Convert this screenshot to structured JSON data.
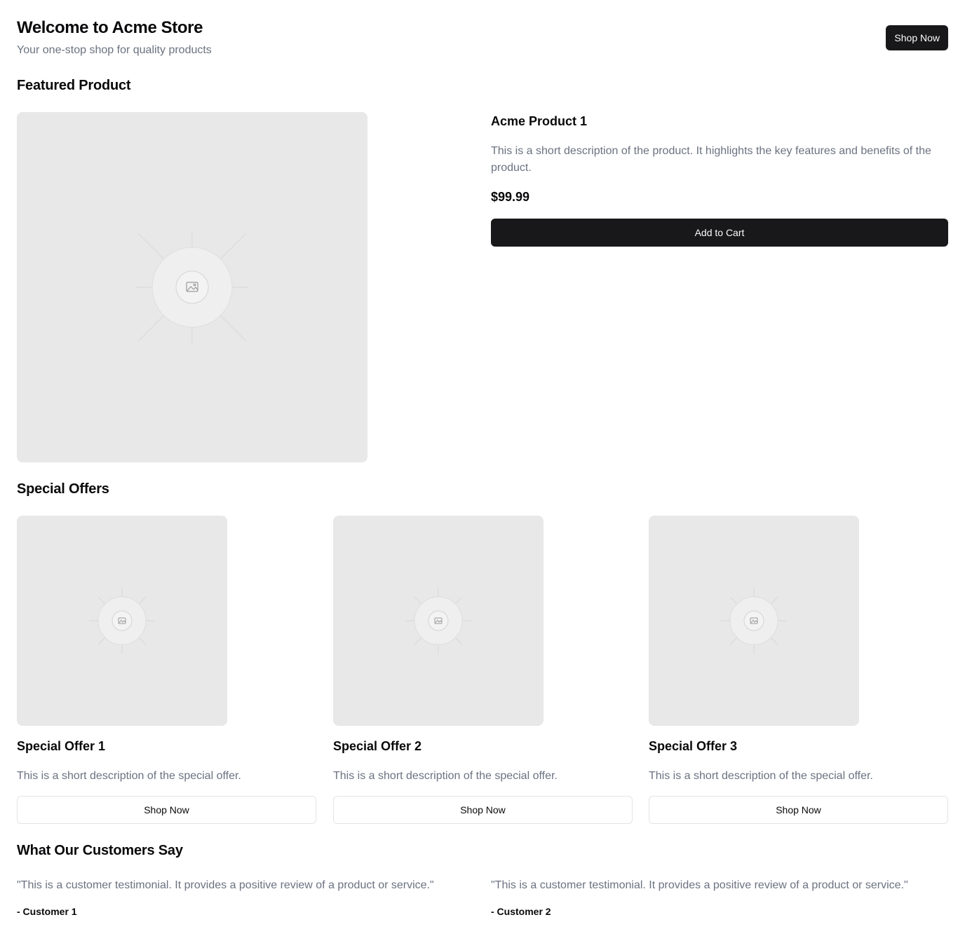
{
  "header": {
    "title": "Welcome to Acme Store",
    "subtitle": "Your one-stop shop for quality products",
    "shop_now_label": "Shop Now"
  },
  "featured": {
    "section_title": "Featured Product",
    "image_icon": "image-placeholder-icon",
    "product_name": "Acme Product 1",
    "description": "This is a short description of the product. It highlights the key features and benefits of the product.",
    "price": "$99.99",
    "add_to_cart_label": "Add to Cart"
  },
  "offers": {
    "section_title": "Special Offers",
    "items": [
      {
        "title": "Special Offer 1",
        "description": "This is a short description of the special offer.",
        "button_label": "Shop Now"
      },
      {
        "title": "Special Offer 2",
        "description": "This is a short description of the special offer.",
        "button_label": "Shop Now"
      },
      {
        "title": "Special Offer 3",
        "description": "This is a short description of the special offer.",
        "button_label": "Shop Now"
      }
    ]
  },
  "testimonials": {
    "section_title": "What Our Customers Say",
    "items": [
      {
        "quote": "\"This is a customer testimonial. It provides a positive review of a product or service.\"",
        "author": "- Customer 1"
      },
      {
        "quote": "\"This is a customer testimonial. It provides a positive review of a product or service.\"",
        "author": "- Customer 2"
      }
    ]
  }
}
